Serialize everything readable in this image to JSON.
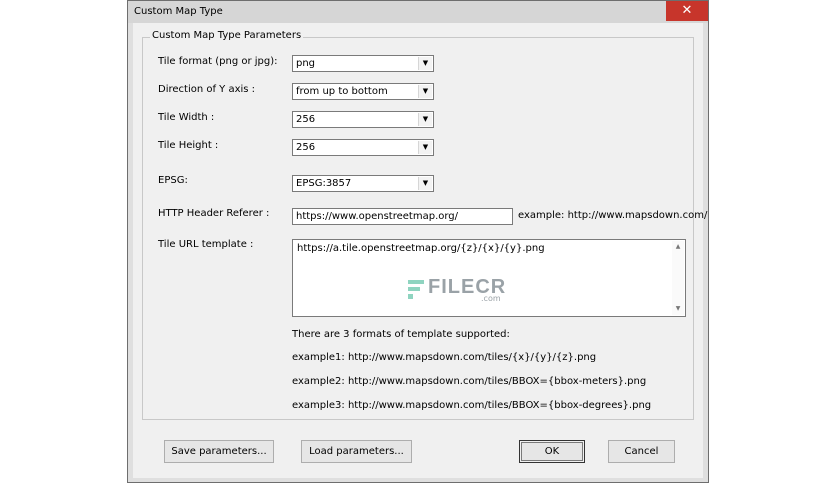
{
  "window": {
    "title": "Custom Map Type",
    "close_label": "✕"
  },
  "group": {
    "title": "Custom Map Type Parameters"
  },
  "fields": {
    "tile_format": {
      "label": "Tile format (png or jpg):",
      "value": "png"
    },
    "y_direction": {
      "label": "Direction of Y axis :",
      "value": "from up to bottom"
    },
    "tile_width": {
      "label": "Tile Width :",
      "value": "256"
    },
    "tile_height": {
      "label": "Tile Height :",
      "value": "256"
    },
    "epsg": {
      "label": "EPSG:",
      "value": "EPSG:3857"
    },
    "referer": {
      "label": "HTTP Header Referer :",
      "value": "https://www.openstreetmap.org/",
      "example": "example: http://www.mapsdown.com/"
    },
    "url_template": {
      "label": "Tile URL template :",
      "value": "https://a.tile.openstreetmap.org/{z}/{x}/{y}.png"
    }
  },
  "watermark": {
    "text": "FILECR",
    "sub": ".com"
  },
  "help": {
    "intro": "There are 3 formats of template supported:",
    "example1": "example1: http://www.mapsdown.com/tiles/{x}/{y}/{z}.png",
    "example2": "example2: http://www.mapsdown.com/tiles/BBOX={bbox-meters}.png",
    "example3": "example3: http://www.mapsdown.com/tiles/BBOX={bbox-degrees}.png"
  },
  "buttons": {
    "save": "Save parameters...",
    "load": "Load parameters...",
    "ok": "OK",
    "cancel": "Cancel"
  }
}
